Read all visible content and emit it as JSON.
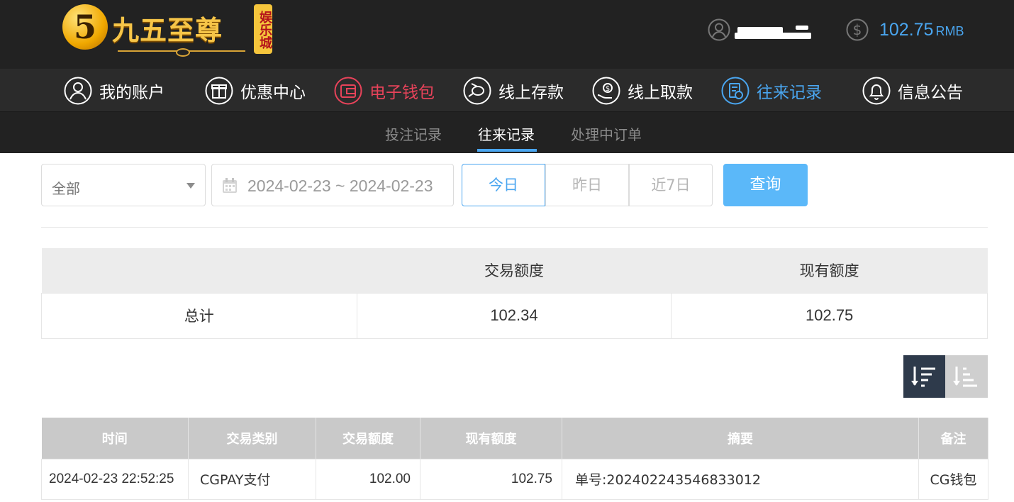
{
  "brand": {
    "badge": "5",
    "name": "九五至尊",
    "tag": "娱乐城"
  },
  "account": {
    "balance": "102.75",
    "currency": "RMB"
  },
  "main_nav": [
    {
      "label": "我的账户",
      "icon": "user-icon"
    },
    {
      "label": "优惠中心",
      "icon": "gift-icon"
    },
    {
      "label": "电子钱包",
      "icon": "wallet-icon",
      "color": "#e8435a"
    },
    {
      "label": "线上存款",
      "icon": "deposit-icon"
    },
    {
      "label": "线上取款",
      "icon": "withdraw-icon"
    },
    {
      "label": "往来记录",
      "icon": "records-icon",
      "color": "#4aa6f0",
      "active": true
    },
    {
      "label": "信息公告",
      "icon": "bell-icon"
    }
  ],
  "sub_nav": [
    {
      "label": "投注记录"
    },
    {
      "label": "往来记录",
      "active": true
    },
    {
      "label": "处理中订单"
    }
  ],
  "filters": {
    "type_selected": "全部",
    "date_range": "2024-02-23 ~ 2024-02-23",
    "quick": [
      "今日",
      "昨日",
      "近7日"
    ],
    "quick_active": "今日",
    "query_label": "查询"
  },
  "summary": {
    "headers": [
      "",
      "交易额度",
      "现有额度"
    ],
    "row": {
      "label": "总计",
      "trade_amount": "102.34",
      "current_amount": "102.75"
    }
  },
  "detail": {
    "headers": [
      "时间",
      "交易类别",
      "交易额度",
      "现有额度",
      "摘要",
      "备注"
    ],
    "rows": [
      {
        "time": "2024-02-23 22:52:25",
        "category": "CGPAY支付",
        "trade_amount": "102.00",
        "current_amount": "102.75",
        "summary": "单号:20240224354683301​2",
        "note": "CG钱包"
      }
    ]
  },
  "colors": {
    "accent": "#4aa6f0",
    "wallet_red": "#e8435a",
    "header_bg": "#222222",
    "sort_active": "#2e3a4b"
  }
}
